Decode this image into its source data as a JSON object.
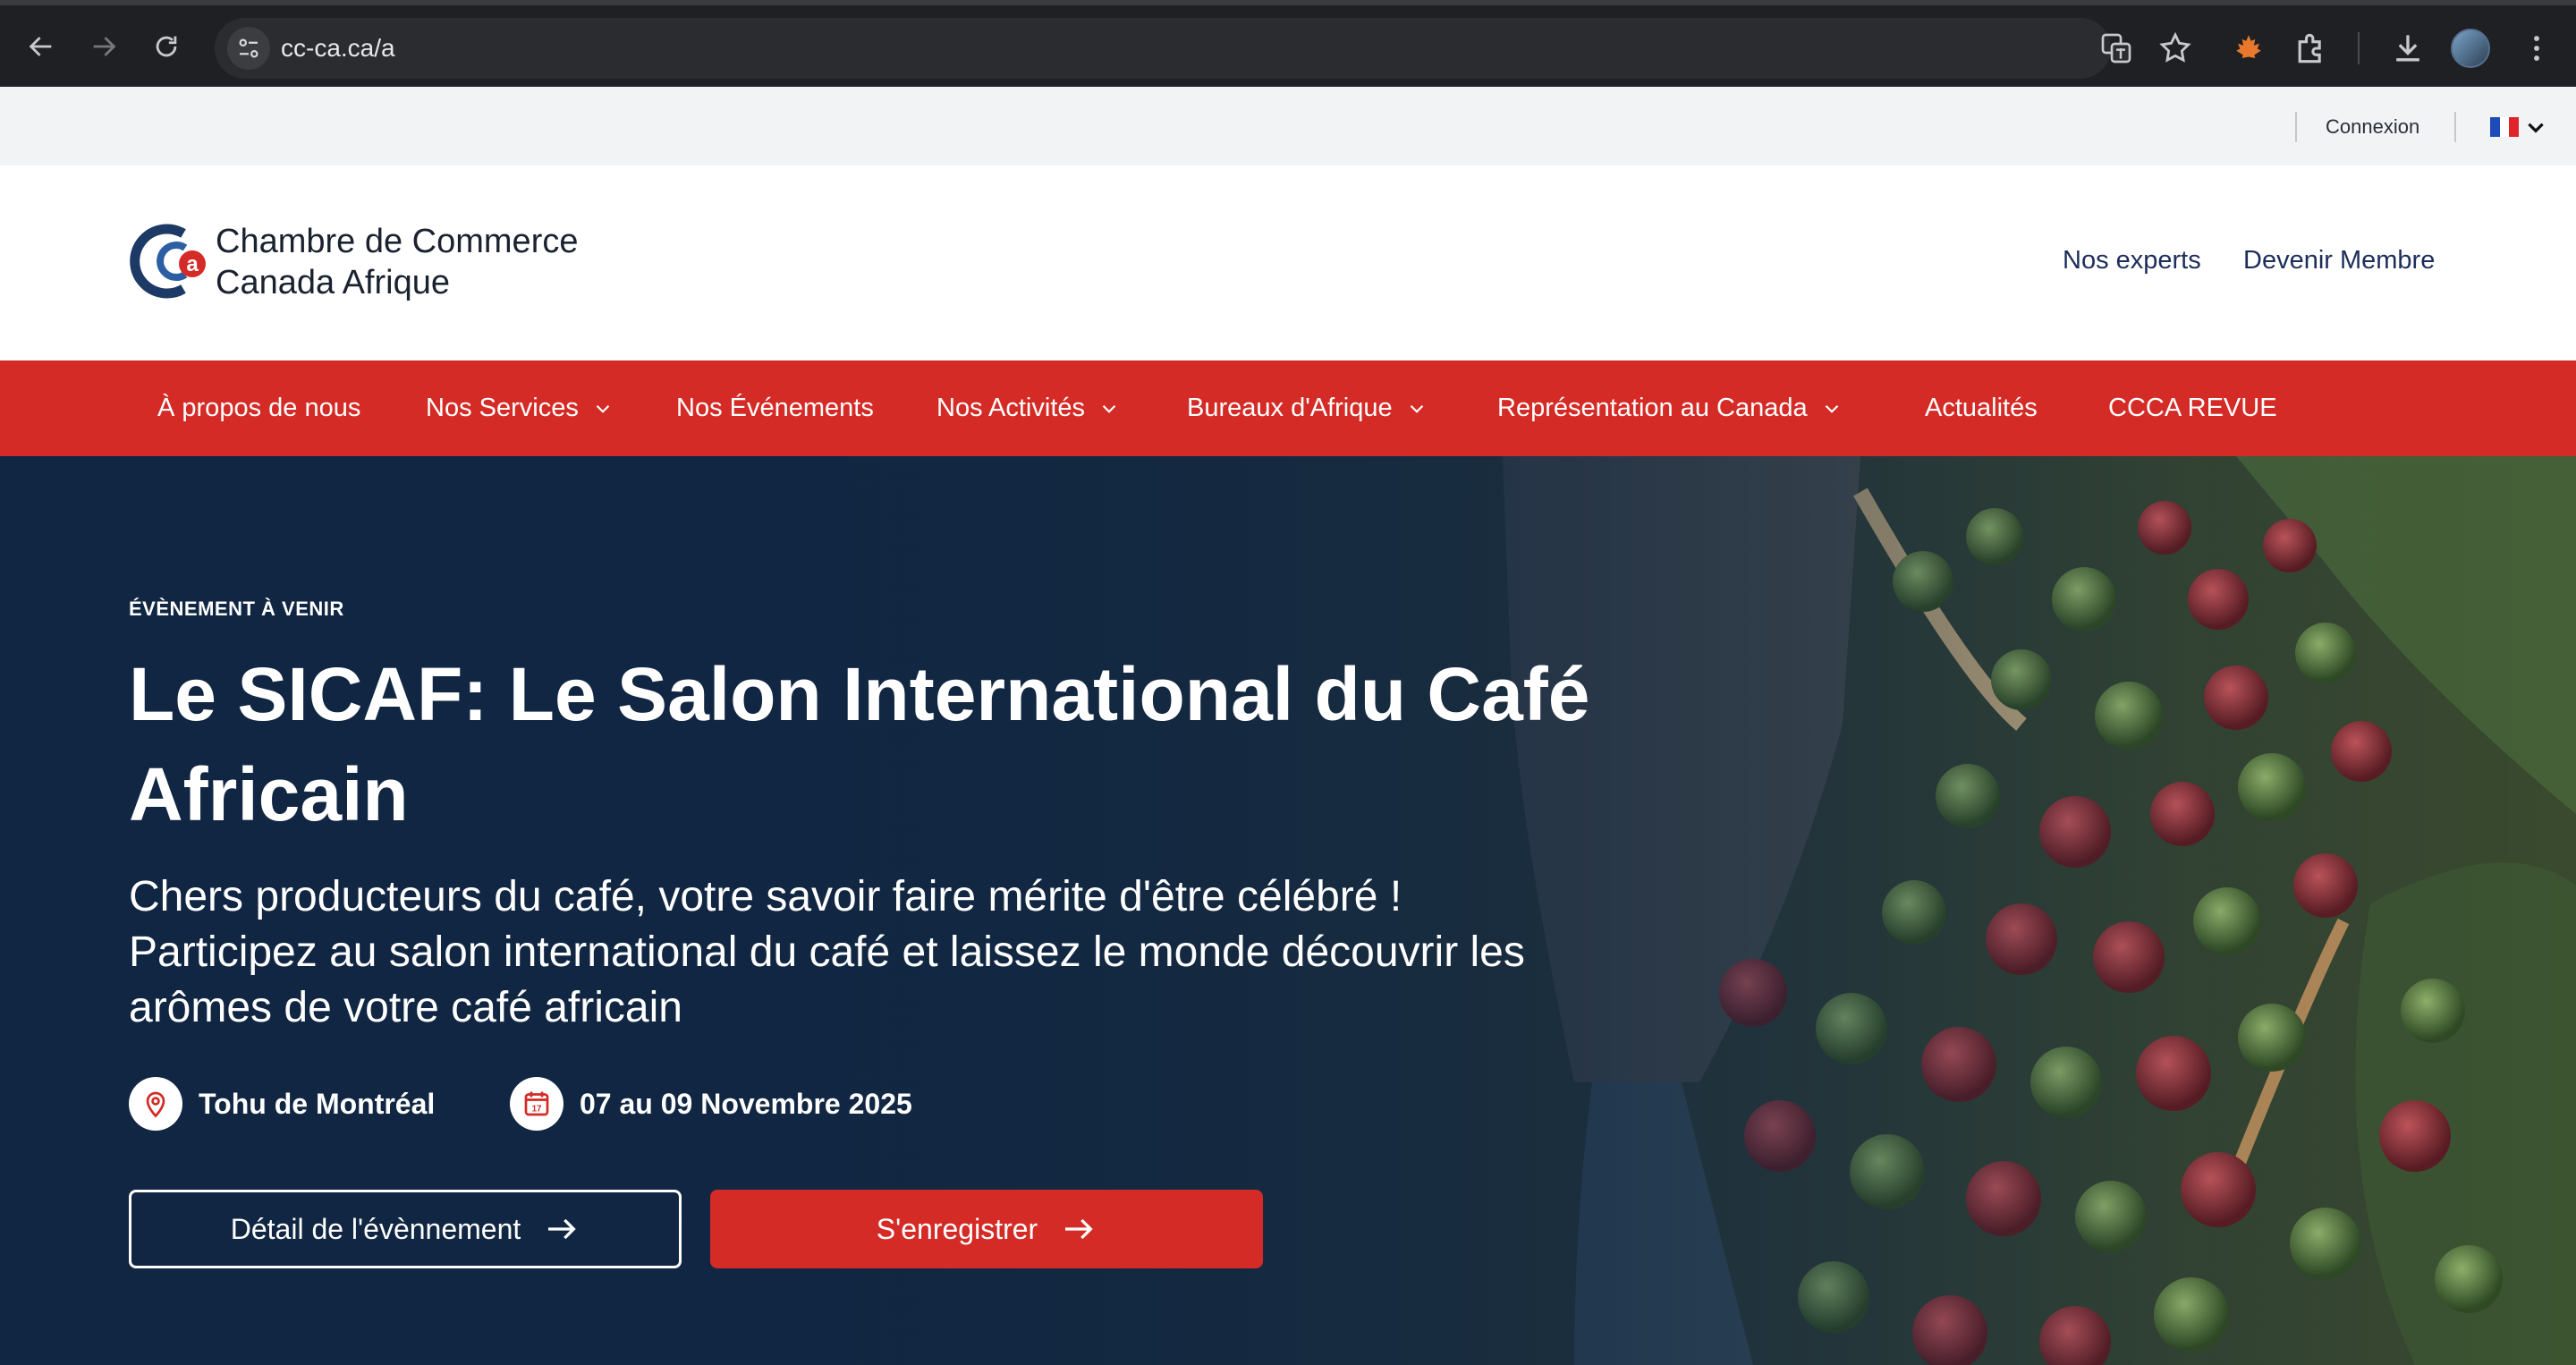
{
  "browser": {
    "url": "cc-ca.ca/a",
    "icons": [
      "back-icon",
      "forward-icon",
      "reload-icon",
      "site-info-icon",
      "translate-icon",
      "bookmark-star-icon",
      "extension-maple-icon",
      "extensions-puzzle-icon",
      "download-icon",
      "profile-avatar",
      "more-menu-icon"
    ]
  },
  "topbar": {
    "login_label": "Connexion",
    "language": "FR"
  },
  "header": {
    "logo_line1": "Chambre de Commerce",
    "logo_line2": "Canada Afrique",
    "logo_mark": "Ca",
    "links": {
      "experts": "Nos experts",
      "become_member": "Devenir Membre"
    }
  },
  "nav": {
    "items": [
      {
        "label": "À propos de nous",
        "dropdown": false
      },
      {
        "label": "Nos Services",
        "dropdown": true
      },
      {
        "label": "Nos Événements",
        "dropdown": false
      },
      {
        "label": "Nos Activités",
        "dropdown": true
      },
      {
        "label": "Bureaux d'Afrique",
        "dropdown": true
      },
      {
        "label": "Représentation au Canada",
        "dropdown": true
      },
      {
        "label": "Actualités",
        "dropdown": false
      },
      {
        "label": "CCCA REVUE",
        "dropdown": false
      }
    ]
  },
  "hero": {
    "eyebrow": "ÉVÈNEMENT À VENIR",
    "title": "Le SICAF: Le Salon International du Café Africain",
    "description": "Chers producteurs du café, votre savoir faire mérite d'être célébré ! Participez au salon international du café et laissez le monde découvrir les arômes de votre café africain",
    "location": "Tohu de Montréal",
    "dates": "07 au 09 Novembre 2025",
    "detail_button": "Détail de l'évènnement",
    "register_button": "S'enregistrer"
  },
  "colors": {
    "brand_red": "#d52b26",
    "brand_navy": "#1d2d5b",
    "hero_overlay": "#102642",
    "chrome_bg": "#1f2023"
  }
}
